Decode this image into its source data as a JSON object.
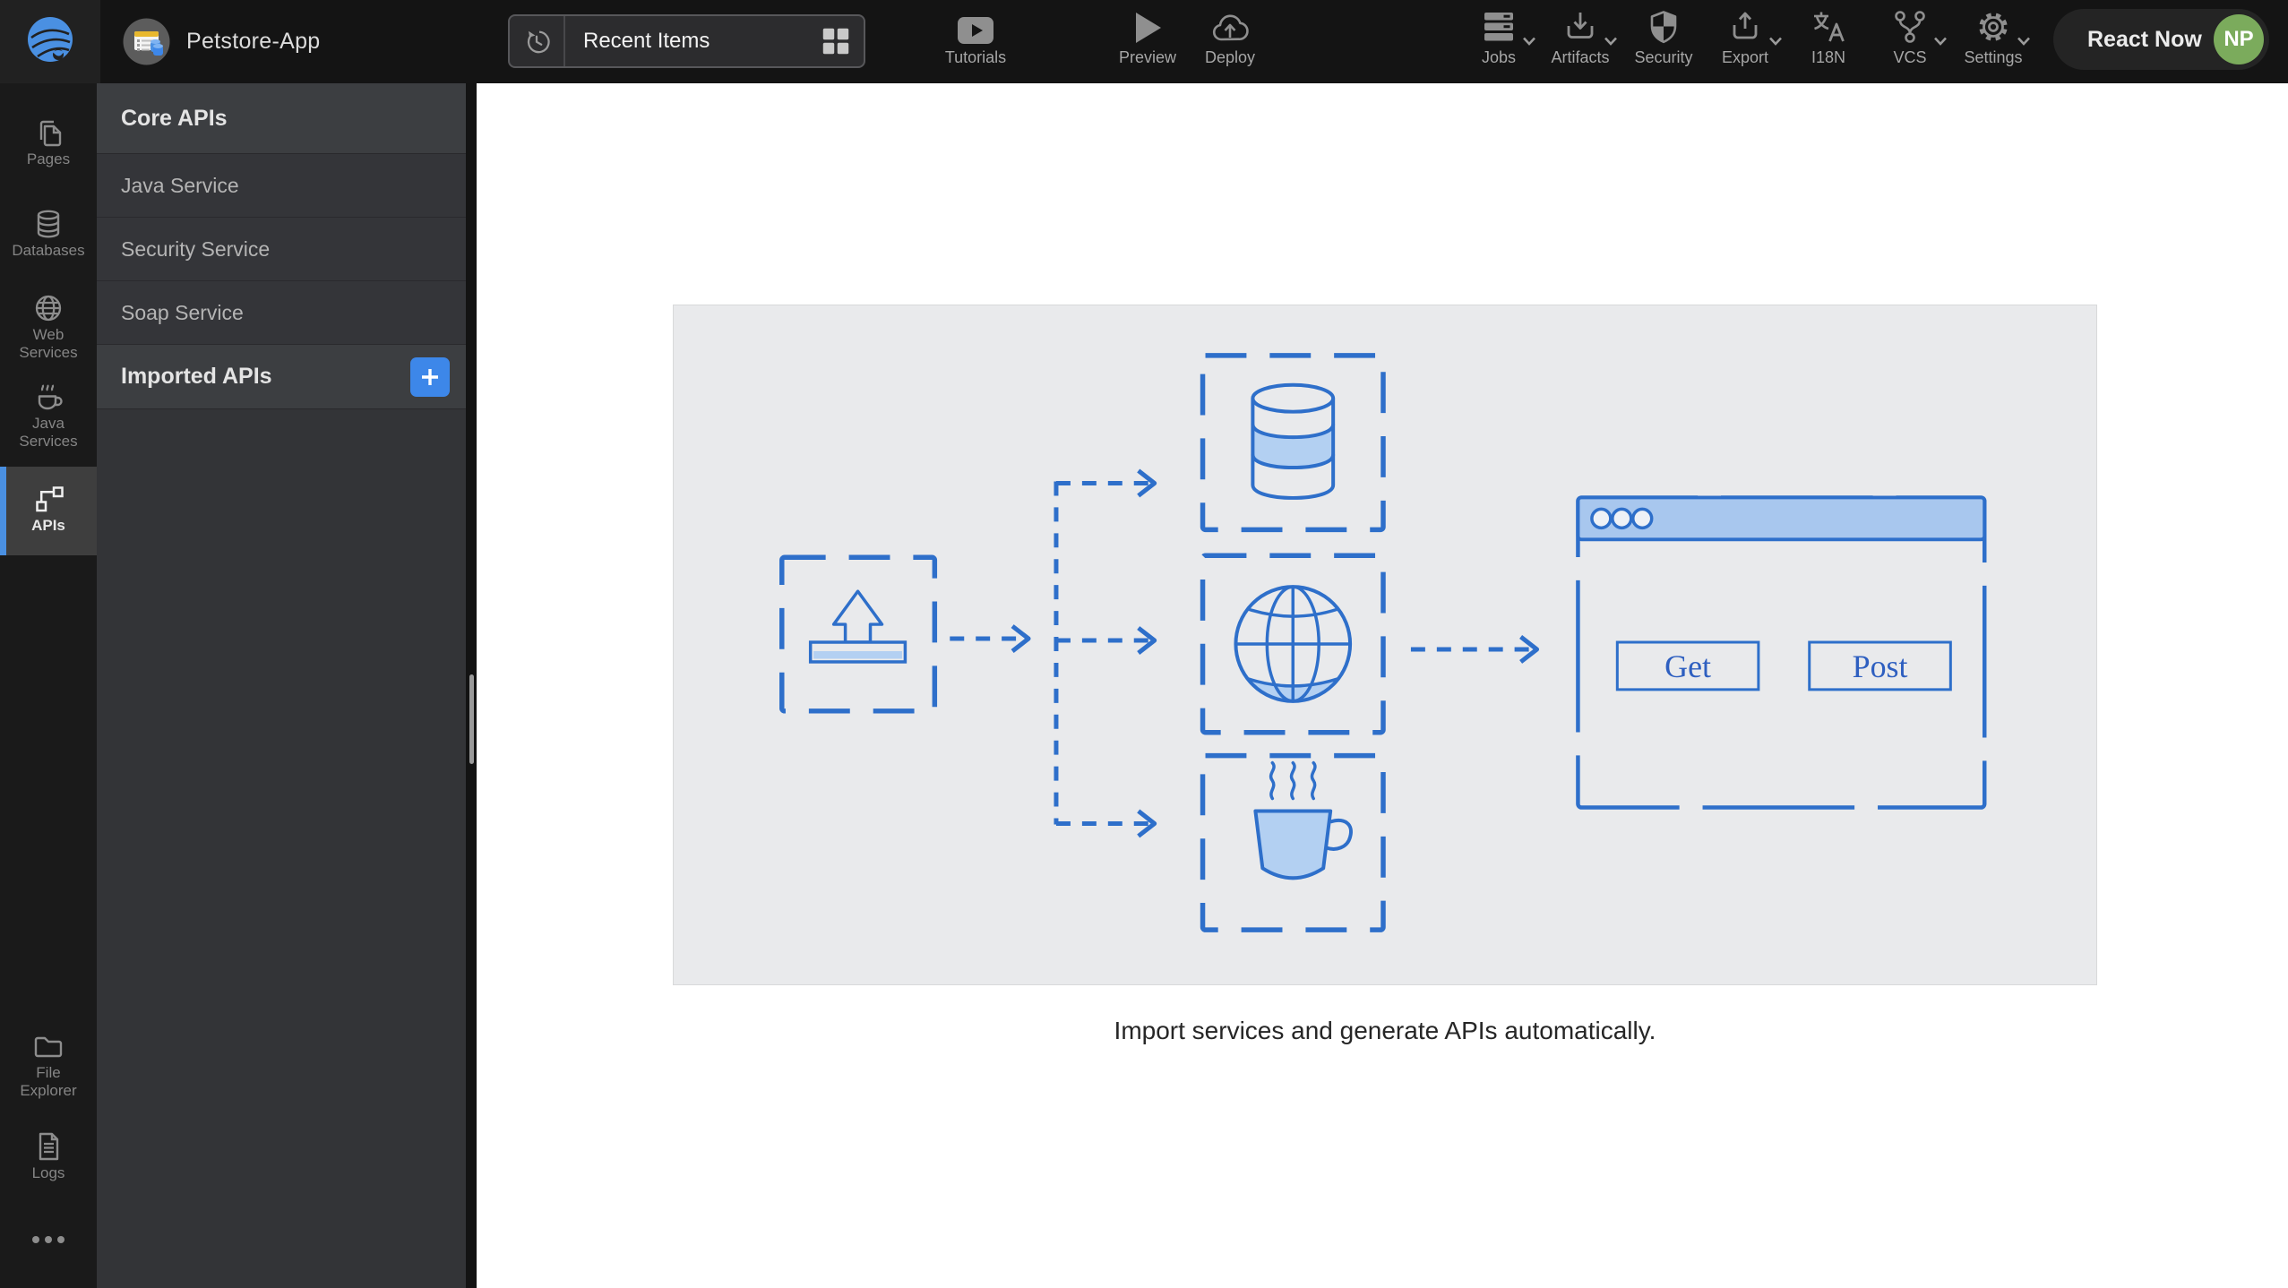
{
  "app": {
    "title": "Petstore-App"
  },
  "header": {
    "recent_items": {
      "label": "Recent Items"
    },
    "toolbar_center": [
      {
        "id": "tutorials",
        "label": "Tutorials"
      },
      {
        "id": "preview",
        "label": "Preview"
      },
      {
        "id": "deploy",
        "label": "Deploy"
      }
    ],
    "toolbar_right": [
      {
        "id": "jobs",
        "label": "Jobs",
        "has_menu": true
      },
      {
        "id": "artifacts",
        "label": "Artifacts",
        "has_menu": true
      },
      {
        "id": "security",
        "label": "Security",
        "has_menu": false
      },
      {
        "id": "export",
        "label": "Export",
        "has_menu": true
      },
      {
        "id": "i18n",
        "label": "I18N",
        "has_menu": false
      },
      {
        "id": "vcs",
        "label": "VCS",
        "has_menu": true
      },
      {
        "id": "settings",
        "label": "Settings",
        "has_menu": true
      }
    ],
    "react_now_label": "React Now",
    "avatar_initials": "NP"
  },
  "sidebar": {
    "items": [
      {
        "id": "pages",
        "label": "Pages",
        "active": false
      },
      {
        "id": "databases",
        "label": "Databases",
        "active": false
      },
      {
        "id": "web-services",
        "label": "Web Services",
        "active": false
      },
      {
        "id": "java-services",
        "label": "Java Services",
        "active": false
      },
      {
        "id": "apis",
        "label": "APIs",
        "active": true
      },
      {
        "id": "file-explorer",
        "label": "File Explorer",
        "active": false
      },
      {
        "id": "logs",
        "label": "Logs",
        "active": false
      }
    ]
  },
  "panel": {
    "sections": [
      {
        "title": "Core APIs",
        "items": [
          "Java Service",
          "Security Service",
          "Soap Service"
        ]
      },
      {
        "title": "Imported APIs",
        "items": [],
        "has_add_button": true
      }
    ]
  },
  "main": {
    "diagram": {
      "icons": [
        "upload",
        "database",
        "globe",
        "coffee",
        "browser-window"
      ],
      "window_buttons": {
        "get": "Get",
        "post": "Post"
      }
    },
    "caption": "Import services and generate APIs automatically."
  },
  "colors": {
    "accent_blue": "#4a90e2",
    "add_button_blue": "#3d87e9",
    "diagram_stroke": "#2e6fca",
    "diagram_fill_light": "#b3d0f2",
    "window_titlebar": "#a8c7ee",
    "diagram_panel_bg": "#e9eaec",
    "avatar_green": "#7bab5c",
    "header_bg": "#141414"
  }
}
